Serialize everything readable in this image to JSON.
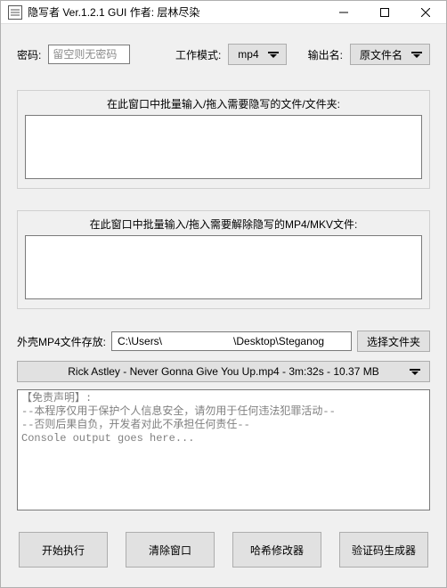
{
  "titlebar": {
    "title": "隐写者 Ver.1.2.1 GUI 作者: 层林尽染"
  },
  "top": {
    "pw_label": "密码:",
    "pw_placeholder": "留空则无密码",
    "mode_label": "工作模式:",
    "mode_value": "mp4",
    "outname_label": "输出名:",
    "outname_value": "原文件名"
  },
  "group_hide": {
    "caption": "在此窗口中批量输入/拖入需要隐写的文件/文件夹:"
  },
  "group_unhide": {
    "caption": "在此窗口中批量输入/拖入需要解除隐写的MP4/MKV文件:"
  },
  "path_row": {
    "label": "外壳MP4文件存放:",
    "value": "C:\\Users\\                        \\Desktop\\Steganog",
    "browse": "选择文件夹"
  },
  "file_select": {
    "text": "Rick Astley - Never Gonna Give You Up.mp4 - 3m:32s - 10.37 MB"
  },
  "console": {
    "lines": "【免责声明】:\n--本程序仅用于保护个人信息安全，请勿用于任何违法犯罪活动--\n--否则后果自负，开发者对此不承担任何责任--\nConsole output goes here..."
  },
  "buttons": {
    "start": "开始执行",
    "clear": "清除窗口",
    "hash": "哈希修改器",
    "verify": "验证码生成器"
  }
}
